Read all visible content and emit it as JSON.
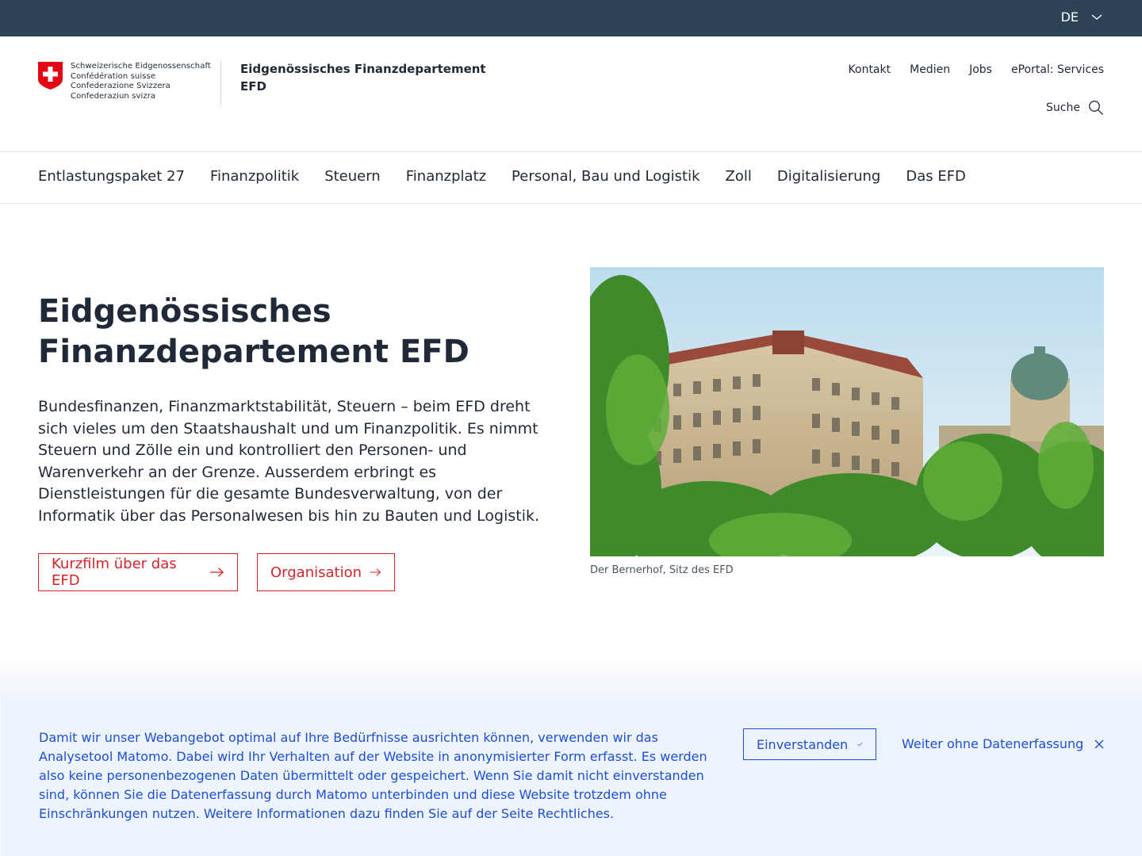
{
  "topbar": {
    "language": "DE",
    "language_icon": "chevron-down-icon"
  },
  "header": {
    "logo_lines": [
      "Schweizerische Eidgenossenschaft",
      "Confédération suisse",
      "Confederazione Svizzera",
      "Confederaziun svizra"
    ],
    "department_line1": "Eidgenössisches Finanzdepartement",
    "department_line2": "EFD",
    "service_nav": [
      "Kontakt",
      "Medien",
      "Jobs",
      "ePortal: Services"
    ],
    "search_label": "Suche",
    "search_icon": "search-icon"
  },
  "main_nav": [
    "Entlastungspaket 27",
    "Finanzpolitik",
    "Steuern",
    "Finanzplatz",
    "Personal, Bau und Logistik",
    "Zoll",
    "Digitalisierung",
    "Das EFD"
  ],
  "hero": {
    "title_line1": "Eidgenössisches",
    "title_line2": "Finanzdepartement EFD",
    "text": "Bundesfinanzen, Finanzmarktstabilität, Steuern – beim EFD dreht sich vieles um den Staatshaushalt und um Finanzpolitik. Es nimmt Steuern und Zölle ein und kontrolliert den Personen- und Warenverkehr an der Grenze. Ausserdem erbringt es Dienstleistungen für die gesamte Bundesverwaltung, von der Informatik über das Personalwesen bis hin zu Bauten und Logistik.",
    "button1": "Kurzfilm über das EFD",
    "button2": "Organisation",
    "caption": "Der Bernerhof, Sitz des EFD"
  },
  "cookie": {
    "text": "Damit wir unser Webangebot optimal auf Ihre Bedürfnisse ausrichten können, verwenden wir das Analysetool Matomo. Dabei wird Ihr Verhalten auf der Website in anonymisierter Form erfasst. Es werden also keine personenbezogenen Daten übermittelt oder gespeichert. Wenn Sie damit nicht einverstanden sind, können Sie die Datenerfassung durch Matomo unterbinden und diese Website trotzdem ohne Einschränkungen nutzen. Weitere Informationen dazu finden Sie auf der Seite Rechtliches.",
    "accept": "Einverstanden",
    "decline": "Weiter ohne Datenerfassung"
  },
  "colors": {
    "topbar": "#2f4356",
    "accent_red": "#d8232a",
    "cookie_blue": "#1d4ed8",
    "cookie_bg": "#eef4fe"
  }
}
